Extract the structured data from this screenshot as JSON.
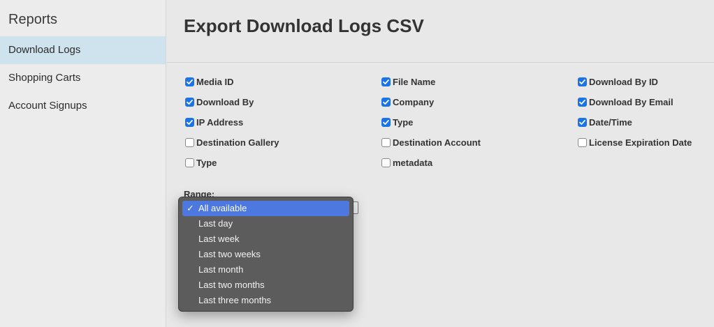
{
  "sidebar": {
    "title": "Reports",
    "items": [
      {
        "label": "Download Logs",
        "active": true
      },
      {
        "label": "Shopping Carts",
        "active": false
      },
      {
        "label": "Account Signups",
        "active": false
      }
    ]
  },
  "main": {
    "title": "Export Download Logs CSV",
    "fields": [
      {
        "label": "Media ID",
        "checked": true
      },
      {
        "label": "File Name",
        "checked": true
      },
      {
        "label": "Download By ID",
        "checked": true
      },
      {
        "label": "Download By",
        "checked": true
      },
      {
        "label": "Company",
        "checked": true
      },
      {
        "label": "Download By Email",
        "checked": true
      },
      {
        "label": "IP Address",
        "checked": true
      },
      {
        "label": "Type",
        "checked": true
      },
      {
        "label": "Date/Time",
        "checked": true
      },
      {
        "label": "Destination Gallery",
        "checked": false
      },
      {
        "label": "Destination Account",
        "checked": false
      },
      {
        "label": "License Expiration Date",
        "checked": false
      },
      {
        "label": "Type",
        "checked": false
      },
      {
        "label": "metadata",
        "checked": false
      }
    ],
    "range": {
      "label": "Range:",
      "selected": "All available",
      "options": [
        "All available",
        "Last day",
        "Last week",
        "Last two weeks",
        "Last month",
        "Last two months",
        "Last three months"
      ]
    }
  },
  "colors": {
    "accent": "#1a73e8",
    "sidebar_active": "#cfe3ee",
    "menu_bg": "#5c5c5c",
    "menu_highlight": "#4d78e0"
  },
  "icons": {
    "checkmark": "checkmark-icon"
  }
}
